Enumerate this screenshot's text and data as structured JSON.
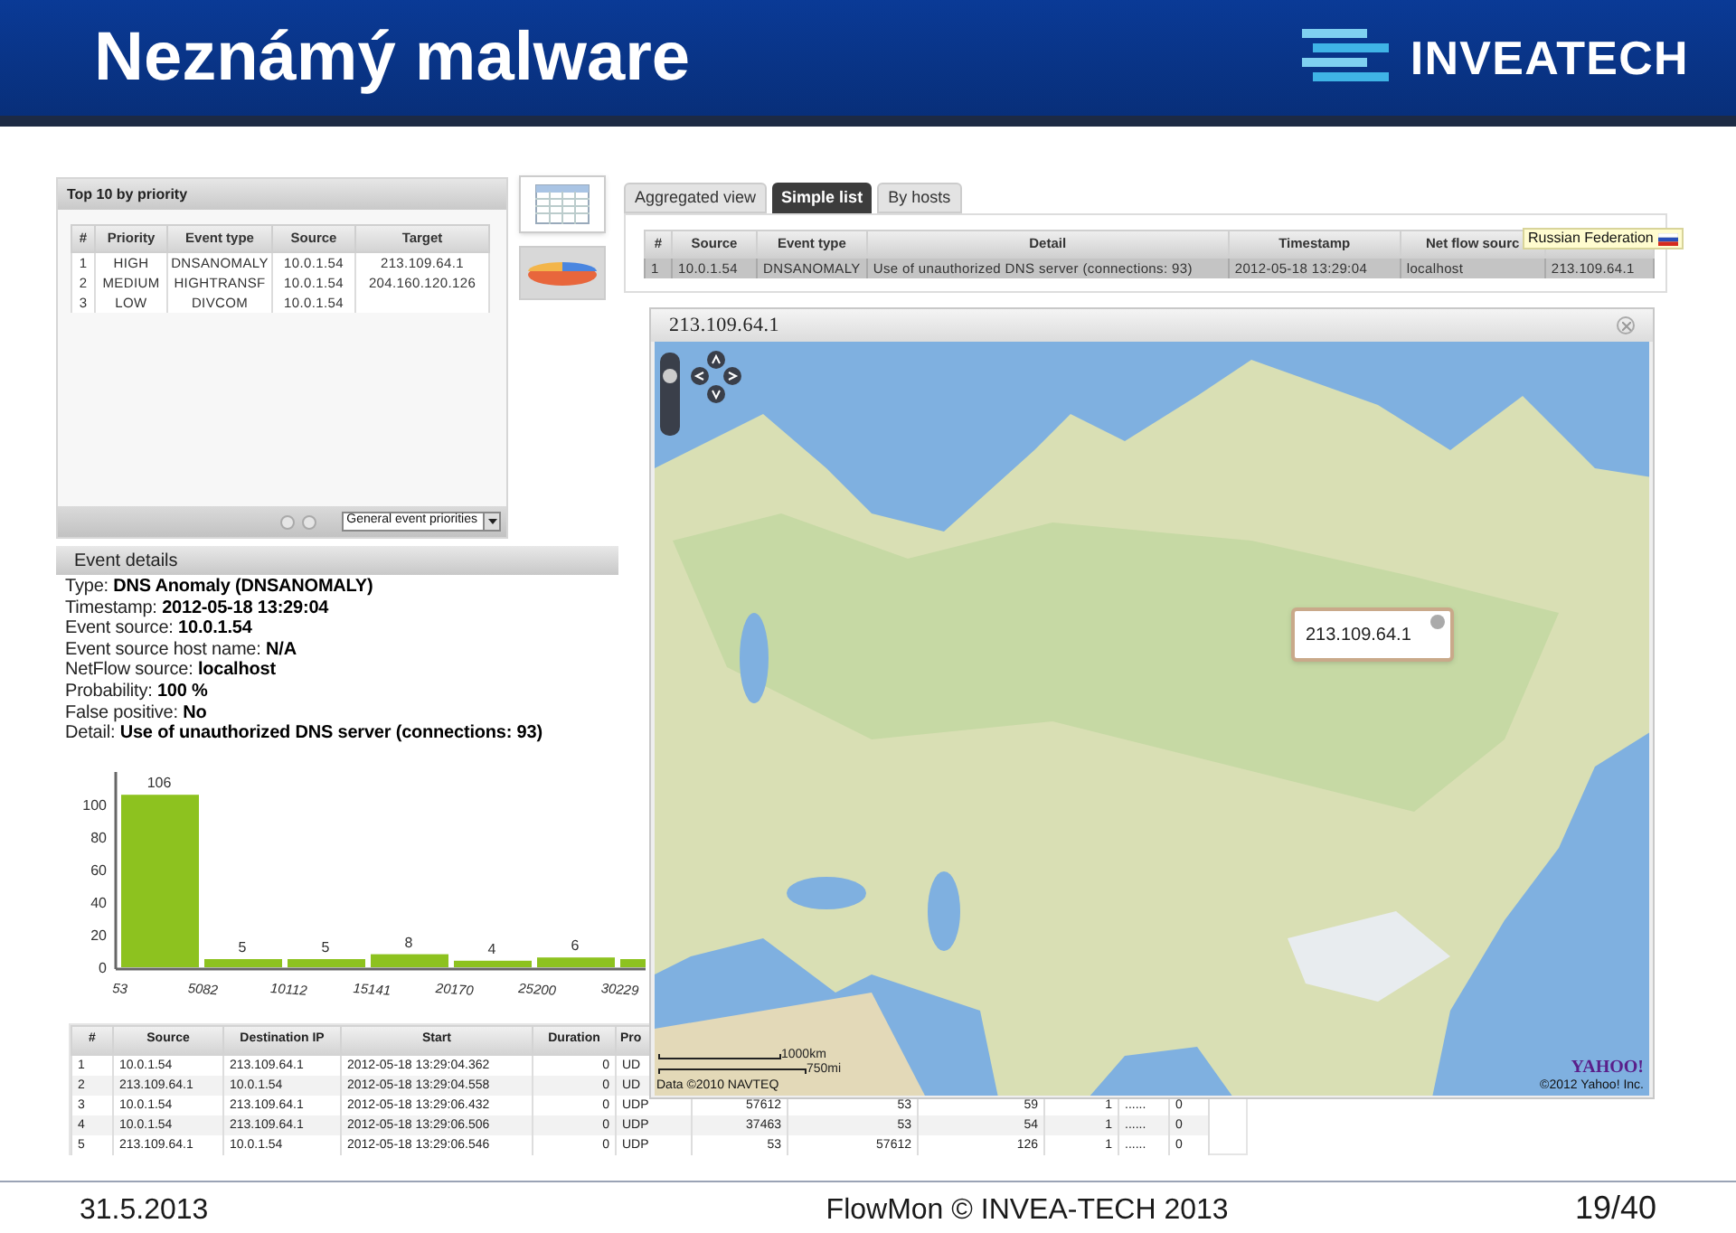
{
  "slide": {
    "title": "Neznámý malware",
    "logo_text": "INVEATECH"
  },
  "priority_panel": {
    "title": "Top 10 by priority",
    "columns": [
      "#",
      "Priority",
      "Event type",
      "Source",
      "Target"
    ],
    "rows": [
      [
        "1",
        "HIGH",
        "DNSANOMALY",
        "10.0.1.54",
        "213.109.64.1"
      ],
      [
        "2",
        "MEDIUM",
        "HIGHTRANSF",
        "10.0.1.54",
        "204.160.120.126"
      ],
      [
        "3",
        "LOW",
        "DIVCOM",
        "10.0.1.54",
        ""
      ]
    ],
    "select": "General event priorities"
  },
  "view_buttons": [
    {
      "kind": "table",
      "selected": true
    },
    {
      "kind": "pie",
      "selected": false
    }
  ],
  "events_panel": {
    "tabs": [
      {
        "label": "Aggregated view",
        "selected": false
      },
      {
        "label": "Simple list",
        "selected": true
      },
      {
        "label": "By hosts",
        "selected": false
      }
    ],
    "columns": [
      "#",
      "Source",
      "Event type",
      "Detail",
      "Timestamp",
      "Net flow sourc"
    ],
    "rows": [
      {
        "selected": true,
        "cells": [
          "1",
          "10.0.1.54",
          "DNSANOMALY",
          "Use of unauthorized DNS server (connections: 93)",
          "2012-05-18 13:29:04",
          "localhost",
          "213.109.64.1"
        ]
      }
    ],
    "tooltip": "Russian Federation"
  },
  "event_details": {
    "title": "Event details",
    "fields": [
      {
        "label": "Type:",
        "value": "DNS Anomaly (DNSANOMALY)"
      },
      {
        "label": "Timestamp:",
        "value": "2012-05-18 13:29:04"
      },
      {
        "label": "Event source:",
        "value": "10.0.1.54"
      },
      {
        "label": "Event source host name:",
        "value": "N/A"
      },
      {
        "label": "NetFlow source:",
        "value": "localhost"
      },
      {
        "label": "Probability:",
        "value": "100 %"
      },
      {
        "label": "False positive:",
        "value": "No"
      },
      {
        "label": "Detail:",
        "value": "Use of unauthorized DNS server (connections: 93)"
      }
    ]
  },
  "histogram": {
    "chart_data": {
      "type": "bar",
      "categories": [
        "53",
        "5082",
        "10112",
        "15141",
        "20170",
        "25200",
        "30229"
      ],
      "values": [
        106,
        5,
        5,
        8,
        4,
        6,
        null
      ],
      "ylim": [
        0,
        120
      ],
      "yticks": [
        0,
        20,
        40,
        60,
        80,
        100
      ],
      "data_labels": true
    }
  },
  "flows_table": {
    "columns": [
      "#",
      "Source",
      "Destination IP",
      "Start",
      "Duration",
      "Pro"
    ],
    "rows": [
      [
        "1",
        "10.0.1.54",
        "213.109.64.1",
        "2012-05-18 13:29:04.362",
        "0",
        "UD"
      ],
      [
        "2",
        "213.109.64.1",
        "10.0.1.54",
        "2012-05-18 13:29:04.558",
        "0",
        "UD"
      ],
      [
        "3",
        "10.0.1.54",
        "213.109.64.1",
        "2012-05-18 13:29:06.432",
        "0",
        "UDP",
        "57612",
        "53",
        "59",
        "1",
        "......",
        "0"
      ],
      [
        "4",
        "10.0.1.54",
        "213.109.64.1",
        "2012-05-18 13:29:06.506",
        "0",
        "UDP",
        "37463",
        "53",
        "54",
        "1",
        "......",
        "0"
      ],
      [
        "5",
        "213.109.64.1",
        "10.0.1.54",
        "2012-05-18 13:29:06.546",
        "0",
        "UDP",
        "53",
        "57612",
        "126",
        "1",
        "......",
        "0"
      ]
    ]
  },
  "map_window": {
    "title": "213.109.64.1",
    "popup": "213.109.64.1",
    "scale": [
      "1000km",
      "750mi"
    ],
    "credits": [
      "Data ©2010 NAVTEQ",
      "©2012 Yahoo! Inc."
    ],
    "logo": "YAHOO!"
  },
  "footer": {
    "date": "31.5.2013",
    "center": "FlowMon © INVEA-TECH 2013",
    "page": "19/40"
  }
}
